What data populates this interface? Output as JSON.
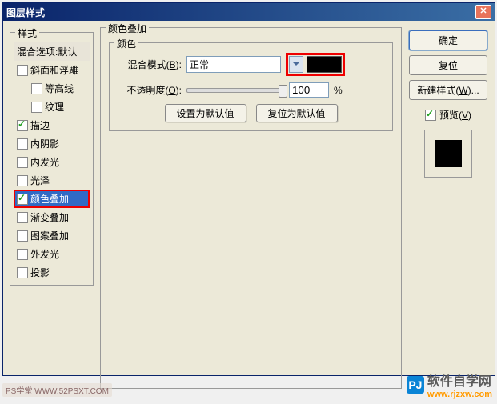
{
  "title": "图层样式",
  "left": {
    "group_title": "样式",
    "items": [
      {
        "label": "混合选项:默认",
        "header": true
      },
      {
        "label": "斜面和浮雕",
        "checked": false
      },
      {
        "label": "等高线",
        "checked": false,
        "indent": true
      },
      {
        "label": "纹理",
        "checked": false,
        "indent": true
      },
      {
        "label": "描边",
        "checked": true
      },
      {
        "label": "内阴影",
        "checked": false
      },
      {
        "label": "内发光",
        "checked": false
      },
      {
        "label": "光泽",
        "checked": false
      },
      {
        "label": "颜色叠加",
        "checked": true,
        "selected": true,
        "highlighted": true
      },
      {
        "label": "渐变叠加",
        "checked": false
      },
      {
        "label": "图案叠加",
        "checked": false
      },
      {
        "label": "外发光",
        "checked": false
      },
      {
        "label": "投影",
        "checked": false
      }
    ]
  },
  "center": {
    "section_title": "颜色叠加",
    "inner_title": "颜色",
    "blend_label_pre": "混合模式(",
    "blend_label_u": "B",
    "blend_label_post": "):",
    "blend_value": "正常",
    "color_value": "#000000",
    "opacity_label_pre": "不透明度(",
    "opacity_label_u": "O",
    "opacity_label_post": "):",
    "opacity_value": "100",
    "opacity_pct": "%",
    "btn_default": "设置为默认值",
    "btn_reset": "复位为默认值"
  },
  "right": {
    "ok": "确定",
    "cancel": "复位",
    "new_style_pre": "新建样式(",
    "new_style_u": "W",
    "new_style_post": ")...",
    "preview_pre": "预览(",
    "preview_u": "V",
    "preview_post": ")",
    "preview_checked": true
  },
  "watermarks": {
    "left": "PS学堂  WWW.52PSXT.COM",
    "r1": "软件自学网",
    "r2": "www.rjzxw.com",
    "logo": "PJ"
  }
}
